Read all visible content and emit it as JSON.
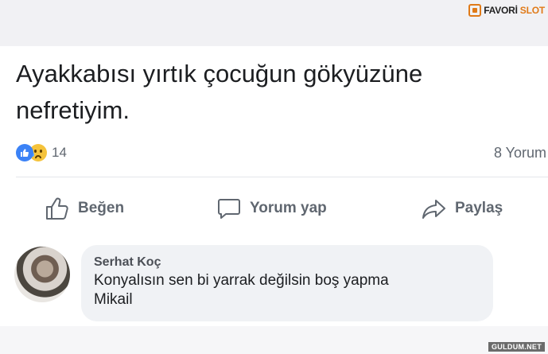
{
  "brand": {
    "word1": "FAVORİ",
    "word2": "SLOT"
  },
  "post": {
    "text": "Ayakkabısı yırtık çocuğun gökyüzüne nefretiyim.",
    "reaction_count": "14",
    "reaction_icons": [
      "like-icon",
      "sad-face-icon"
    ],
    "comment_count_label": "8 Yorum"
  },
  "actions": {
    "like_label": "Beğen",
    "comment_label": "Yorum yap",
    "share_label": "Paylaş"
  },
  "comment": {
    "author": "Serhat Koç",
    "text_line1": "Konyalısın sen bi yarrak değilsin boş yapma",
    "text_line2": "Mikail"
  },
  "watermark": "GULDUM.NET",
  "colors": {
    "accent": "#3b82f6",
    "brand": "#e07a18",
    "muted": "#606770"
  }
}
